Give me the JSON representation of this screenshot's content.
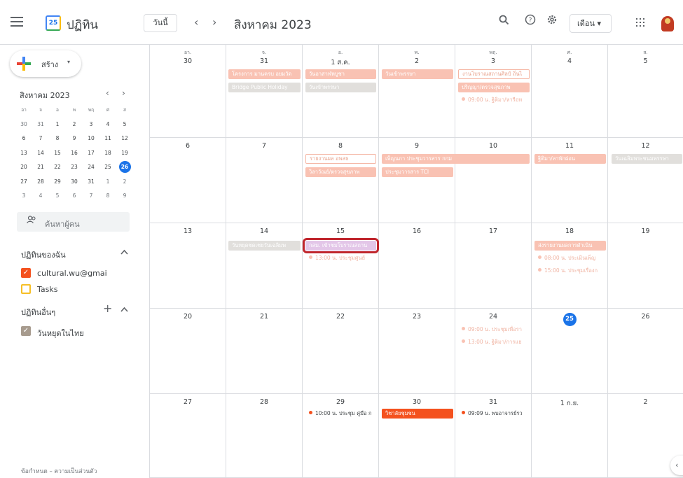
{
  "header": {
    "app_title": "ปฏิทิน",
    "logo_day": "25",
    "today_label": "วันนี้",
    "prev_symbol": "‹",
    "next_symbol": "›",
    "month_title": "สิงหาคม 2023",
    "search_symbol": "🔍",
    "help_symbol": "?",
    "settings_symbol": "⚙",
    "view_label": "เดือน ▾"
  },
  "sidebar": {
    "create_label": "สร้าง",
    "create_caret": "▾",
    "mini_title": "สิงหาคม 2023",
    "mini_prev": "‹",
    "mini_next": "›",
    "mini_dows": [
      "อา",
      "จ",
      "อ",
      "พ",
      "พฤ",
      "ศ",
      "ส"
    ],
    "mini_days": [
      "30",
      "31",
      "1",
      "2",
      "3",
      "4",
      "5",
      "6",
      "7",
      "8",
      "9",
      "10",
      "11",
      "12",
      "13",
      "14",
      "15",
      "16",
      "17",
      "18",
      "19",
      "20",
      "21",
      "22",
      "23",
      "24",
      "25",
      "26",
      "27",
      "28",
      "29",
      "30",
      "31",
      "1",
      "2",
      "3",
      "4",
      "5",
      "6",
      "7",
      "8",
      "9"
    ],
    "search_people": "ค้นหาผู้คน",
    "my_calendars_title": "ปฏิทินของฉัน",
    "my_calendars": [
      {
        "label": "cultural.wu@gmai",
        "checked": true,
        "color": "#f4511e"
      },
      {
        "label": "Tasks",
        "checked": false,
        "color": "#f6bf26"
      }
    ],
    "other_calendars_title": "ปฏิทินอื่นๆ",
    "other_calendars": [
      {
        "label": "วันหยุดในไทย",
        "checked": true,
        "color": "#a79b8e"
      }
    ],
    "footer": "ข้อกำหนด – ความเป็นส่วนตัว"
  },
  "calendar": {
    "dows": [
      "อา.",
      "จ.",
      "อ.",
      "พ.",
      "พฤ.",
      "ศ.",
      "ส."
    ],
    "weeks": [
      [
        "30",
        "31",
        "1 ส.ค.",
        "2",
        "3",
        "4",
        "5"
      ],
      [
        "6",
        "7",
        "8",
        "9",
        "10",
        "11",
        "12"
      ],
      [
        "13",
        "14",
        "15",
        "16",
        "17",
        "18",
        "19"
      ],
      [
        "20",
        "21",
        "22",
        "23",
        "24",
        "25",
        "26"
      ],
      [
        "27",
        "28",
        "29",
        "30",
        "31",
        "1 ก.ย.",
        "2"
      ]
    ],
    "today_date": "25",
    "events": {
      "w0_mon_1": "โครงการ มานครบ อยมวัด",
      "w0_mon_2": "Bridge Public Holiday",
      "w0_tue_1": "วันอาสาฬหบูชา",
      "w0_tue_2": "วันเข้าพรรษา",
      "w0_wed_1": "วันเข้าพรรษา",
      "w0_thu_1": "งานโบราณสถานศิลป์ ถิ่นไ",
      "w0_thu_2": "ปริญญา/ตรวจสุขภาพ",
      "w0_thu_3": "09:00 น. ฐิติมา/หารือท",
      "w1_tue_1": "รายงานผล อพสธ",
      "w1_tue_2": "วิลาวัณย์/ตรวจสุขภาพ",
      "w1_wed_1": "เพ็ญนภา ประชุมวารสาร กกม",
      "w1_wed_2": "ประชุมวารสาร TCI",
      "w1_fri_1": "ฐิติมา/ลาพักผ่อน",
      "w1_sat_1": "วันเฉลิมพระชนมพรรษา",
      "w2_mon_1": "วันหยุดชดเชยวันเฉลิมพ",
      "w2_tue_1": "กสม. เข้าชมโบราณสถาน",
      "w2_tue_2": "13:00 น. ประชุมศูนย์",
      "w2_fri_1": "ส่งรายงานผลการดำเนิน",
      "w2_fri_2": "08:00 น. ประเมินเพ็ญ",
      "w2_fri_3": "15:00 น. ประชุมเรื่องก",
      "w3_thu_1": "09:00 น. ประชุมเพื่อรา",
      "w3_thu_2": "13:00 น. ฐิติมา/การแย",
      "w4_tue_1": "10:00 น. ประชุม คู่มือ ก",
      "w4_wed_1": "วิชาลัยชุมชน",
      "w4_thu_1": "09:09 น. พบอาจารย์รว"
    }
  },
  "side_panel_toggle": "‹"
}
